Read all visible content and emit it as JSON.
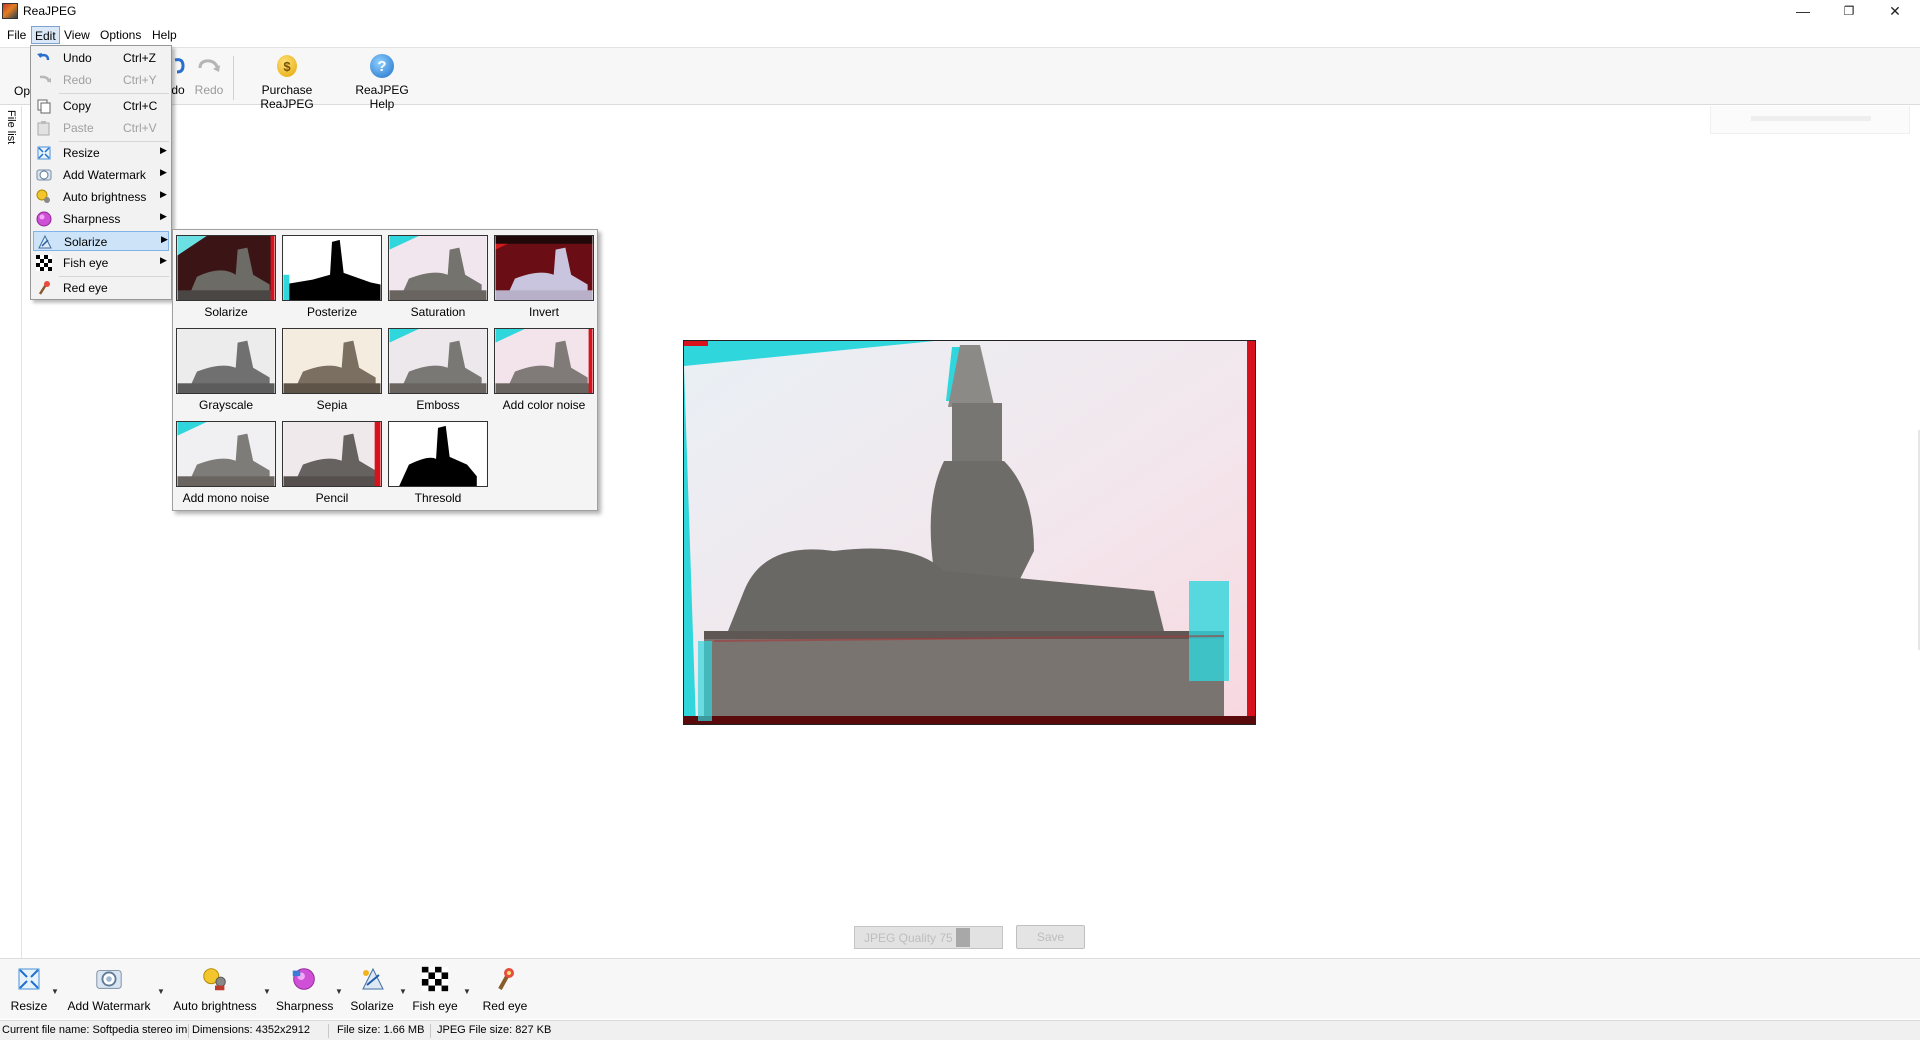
{
  "window": {
    "title": "ReaJPEG",
    "minimize": "—",
    "restore": "❐",
    "close": "✕"
  },
  "menubar": {
    "file": "File",
    "edit": "Edit",
    "view": "View",
    "options": "Options",
    "help": "Help"
  },
  "toolbar": {
    "open_partial": "Op",
    "undo_partial": "do",
    "redo": "Redo",
    "purchase": "Purchase ReaJPEG",
    "purchase_icon_text": "$",
    "help": "ReaJPEG Help",
    "help_icon_text": "?"
  },
  "left_panel": {
    "file_list_tab": "File list"
  },
  "edit_menu": {
    "items": [
      {
        "label": "Undo",
        "shortcut": "Ctrl+Z",
        "icon": "undo-icon",
        "enabled": true
      },
      {
        "label": "Redo",
        "shortcut": "Ctrl+Y",
        "icon": "redo-icon",
        "enabled": false
      },
      {
        "label": "Copy",
        "shortcut": "Ctrl+C",
        "icon": "copy-icon",
        "enabled": true
      },
      {
        "label": "Paste",
        "shortcut": "Ctrl+V",
        "icon": "paste-icon",
        "enabled": false
      },
      {
        "label": "Resize",
        "shortcut": "",
        "icon": "resize-icon",
        "enabled": true
      },
      {
        "label": "Add Watermark",
        "shortcut": "",
        "icon": "watermark-icon",
        "enabled": true
      },
      {
        "label": "Auto brightness",
        "shortcut": "",
        "icon": "brightness-icon",
        "enabled": true
      },
      {
        "label": "Sharpness",
        "shortcut": "",
        "icon": "sharpness-icon",
        "enabled": true
      },
      {
        "label": "Solarize",
        "shortcut": "",
        "icon": "solarize-icon",
        "enabled": true,
        "highlighted": true
      },
      {
        "label": "Fish eye",
        "shortcut": "",
        "icon": "fish-eye-icon",
        "enabled": true
      },
      {
        "label": "Red eye",
        "shortcut": "",
        "icon": "red-eye-icon",
        "enabled": true
      }
    ],
    "submenu_arrow": "▶"
  },
  "solarize_popup": {
    "effects": [
      "Solarize",
      "Posterize",
      "Saturation",
      "Invert",
      "Grayscale",
      "Sepia",
      "Emboss",
      "Add color noise",
      "Add mono noise",
      "Pencil",
      "Thresold"
    ]
  },
  "controls": {
    "jpeg_quality": "JPEG Quality 75",
    "save": "Save"
  },
  "bottom_toolbar": {
    "resize": "Resize",
    "add_watermark": "Add Watermark",
    "auto_brightness": "Auto brightness",
    "sharpness": "Sharpness",
    "solarize": "Solarize",
    "fish_eye": "Fish eye",
    "red_eye": "Red eye",
    "dropdown_arrow": "▼"
  },
  "statusbar": {
    "file_name": "Current file name:  Softpedia stereo im",
    "dimensions": "Dimensions:  4352x2912",
    "file_size": "File size:  1.66 MB",
    "jpeg_file_size": "JPEG File size:  827 KB"
  },
  "colors": {
    "highlight": "#cde3f8",
    "anaglyph_red": "#d8121c",
    "anaglyph_cyan": "#2fd6dc"
  }
}
